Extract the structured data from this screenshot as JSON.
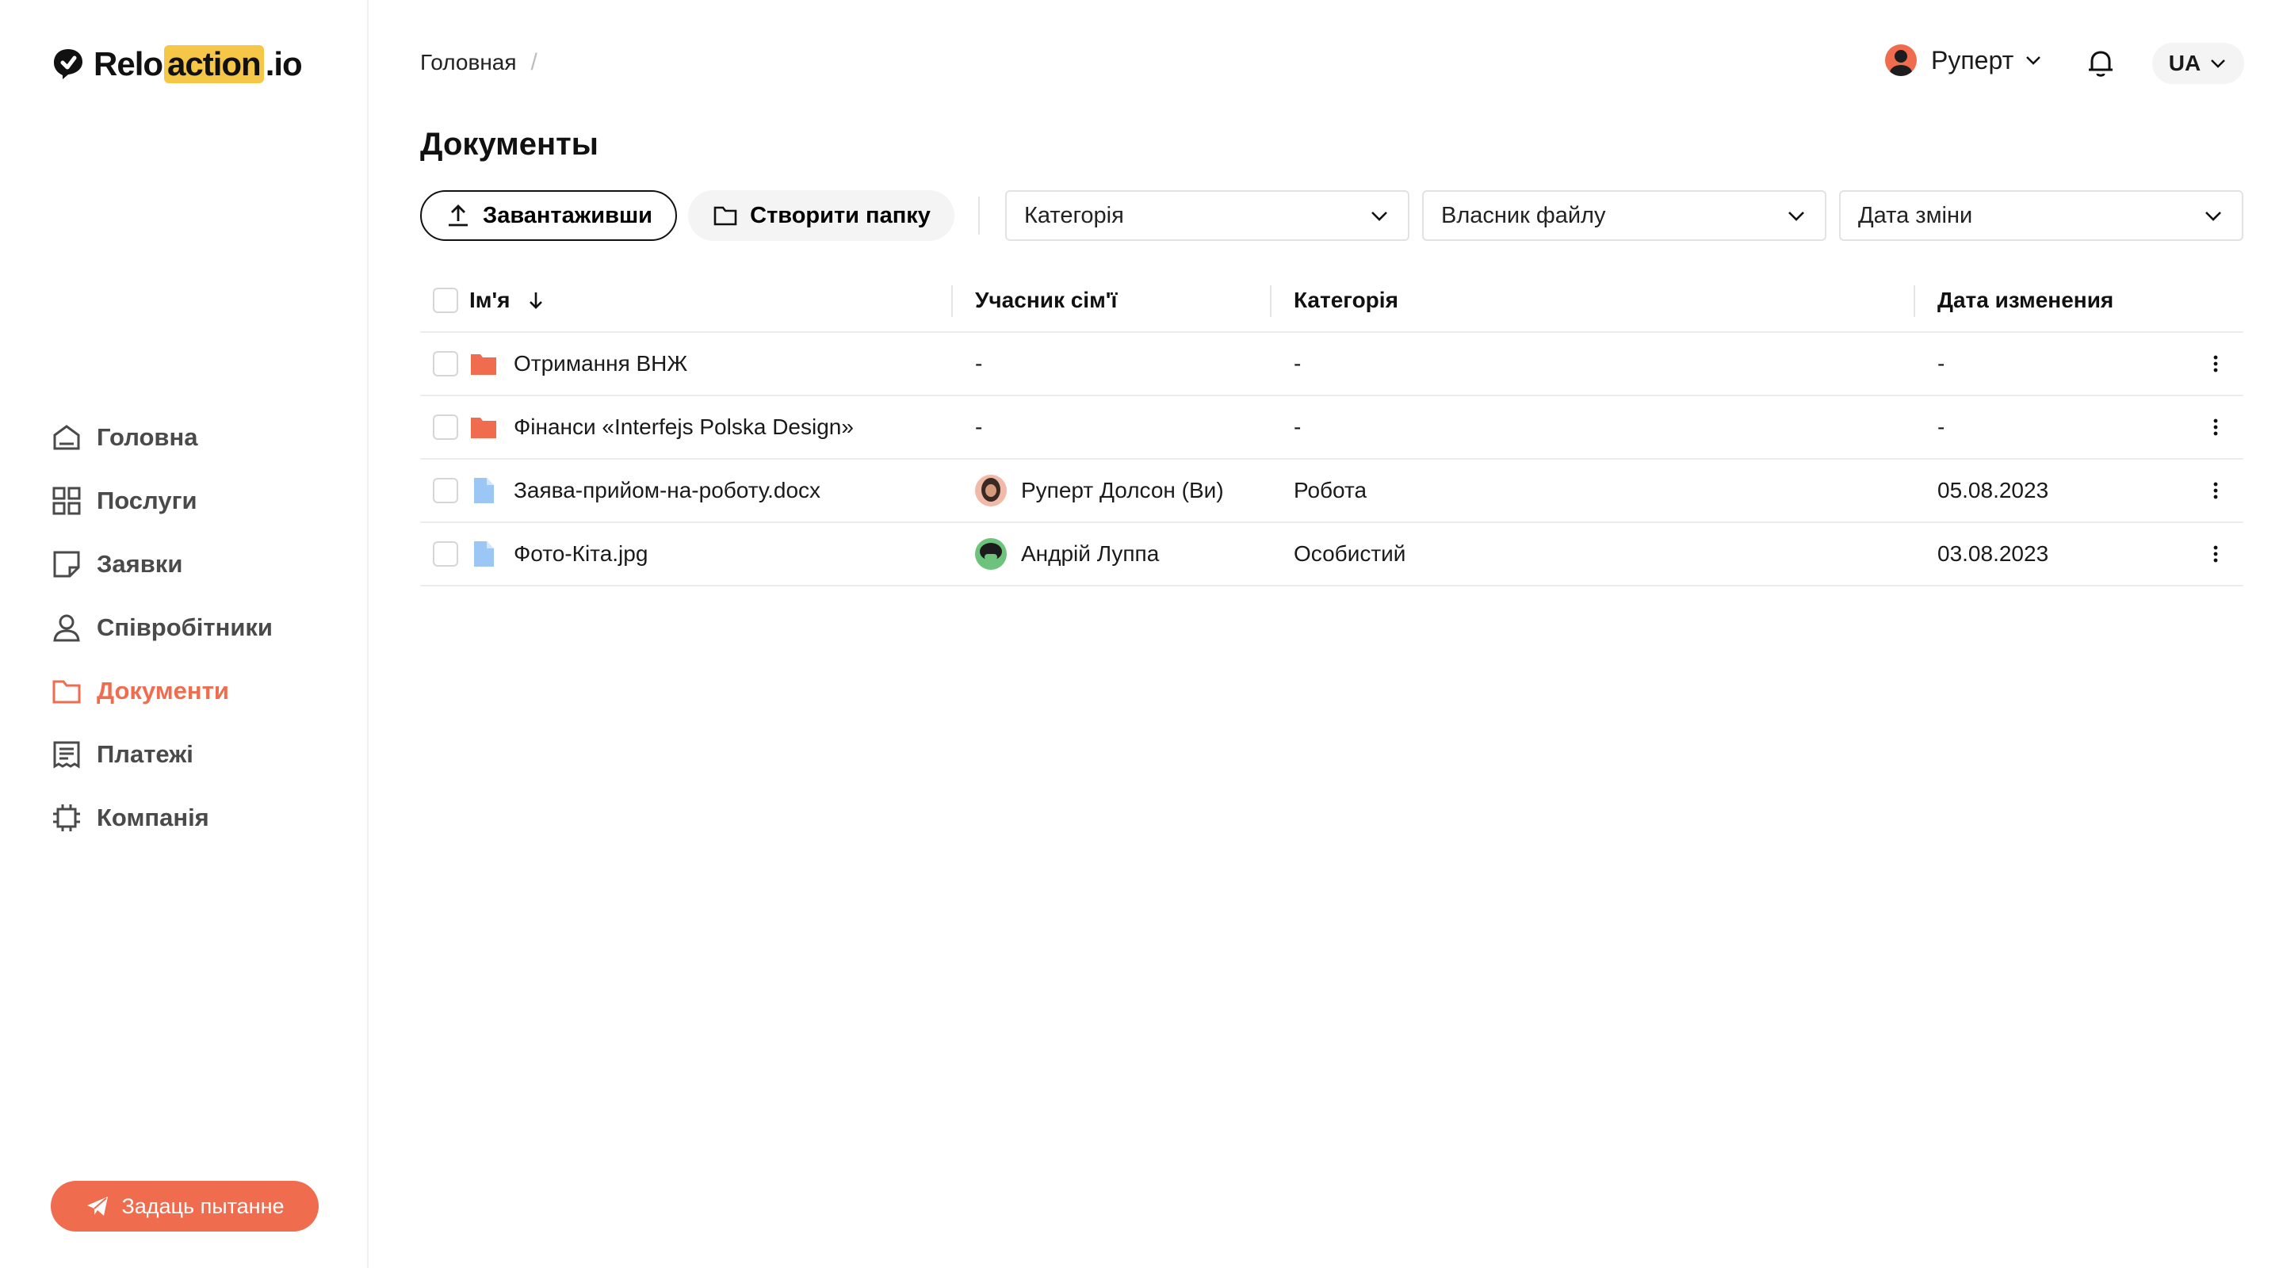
{
  "app": {
    "logo": {
      "pre": "Relo",
      "highlight": "action",
      "post": ".io"
    }
  },
  "sidebar": {
    "items": [
      {
        "label": "Головна",
        "icon": "home-icon"
      },
      {
        "label": "Послуги",
        "icon": "grid-icon"
      },
      {
        "label": "Заявки",
        "icon": "note-icon"
      },
      {
        "label": "Співробітники",
        "icon": "user-icon"
      },
      {
        "label": "Документи",
        "icon": "folder-icon",
        "active": true
      },
      {
        "label": "Платежі",
        "icon": "receipt-icon"
      },
      {
        "label": "Компанія",
        "icon": "chip-icon"
      }
    ],
    "ask_button": "Задаць пытанне"
  },
  "header": {
    "breadcrumb": {
      "home": "Головная",
      "separator": "/"
    },
    "user_name": "Руперт",
    "language": "UA"
  },
  "page": {
    "title": "Документы",
    "upload_button": "Завантаживши",
    "create_folder_button": "Створити папку",
    "filters": {
      "category": "Категорія",
      "owner": "Власник файлу",
      "date": "Дата зміни"
    }
  },
  "table": {
    "columns": {
      "name": "Ім'я",
      "member": "Учасник сім'ї",
      "category": "Категорія",
      "date": "Дата изменения"
    },
    "rows": [
      {
        "type": "folder",
        "name": "Отримання ВНЖ",
        "member": "-",
        "category": "-",
        "date": "-"
      },
      {
        "type": "folder",
        "name": "Фінанси «Interfejs Polska Design»",
        "member": "-",
        "category": "-",
        "date": "-"
      },
      {
        "type": "file",
        "name": "Заява-прийом-на-роботу.docx",
        "member": "Руперт Долсон (Ви)",
        "avatar": "a",
        "category": "Робота",
        "date": "05.08.2023"
      },
      {
        "type": "file",
        "name": "Фото-Кіта.jpg",
        "member": "Андрій Луппа",
        "avatar": "b",
        "category": "Особистий",
        "date": "03.08.2023"
      }
    ]
  },
  "colors": {
    "accent": "#ef6c4f",
    "logo_highlight": "#f6c646",
    "file_icon": "#9cc7f4"
  }
}
